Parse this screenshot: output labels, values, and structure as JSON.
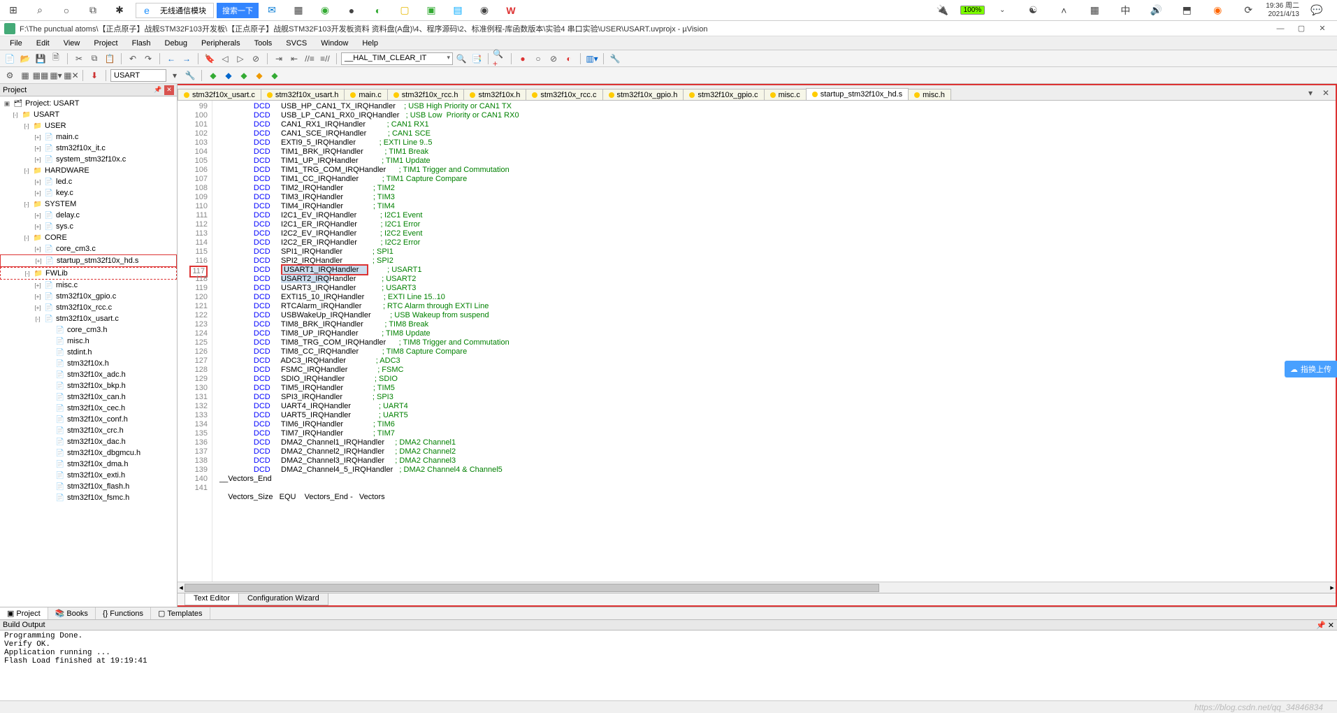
{
  "taskbar": {
    "search_placeholder": "无线通信模块",
    "search_btn": "搜索一下",
    "battery": "100%",
    "clock_time": "19:36 周二",
    "clock_date": "2021/4/13"
  },
  "titlebar": {
    "path": "F:\\The punctual atoms\\【正点原子】战舰STM32F103开发板\\【正点原子】战舰STM32F103开发板资料 资料盘(A盘)\\4、程序源码\\2、标准例程-库函数版本\\实验4 串口实验\\USER\\USART.uvprojx - µVision"
  },
  "menubar": {
    "items": [
      "File",
      "Edit",
      "View",
      "Project",
      "Flash",
      "Debug",
      "Peripherals",
      "Tools",
      "SVCS",
      "Window",
      "Help"
    ]
  },
  "toolbar1": {
    "define": "__HAL_TIM_CLEAR_IT"
  },
  "toolbar2": {
    "target": "USART"
  },
  "project": {
    "header": "Project",
    "root": "Project: USART",
    "tree": [
      {
        "d": 1,
        "t": "folder",
        "exp": "-",
        "label": "USART"
      },
      {
        "d": 2,
        "t": "folder",
        "exp": "-",
        "label": "USER"
      },
      {
        "d": 3,
        "t": "file",
        "exp": "+",
        "label": "main.c"
      },
      {
        "d": 3,
        "t": "file",
        "exp": "+",
        "label": "stm32f10x_it.c"
      },
      {
        "d": 3,
        "t": "file",
        "exp": "+",
        "label": "system_stm32f10x.c"
      },
      {
        "d": 2,
        "t": "folder",
        "exp": "-",
        "label": "HARDWARE"
      },
      {
        "d": 3,
        "t": "file",
        "exp": "+",
        "label": "led.c"
      },
      {
        "d": 3,
        "t": "file",
        "exp": "+",
        "label": "key.c"
      },
      {
        "d": 2,
        "t": "folder",
        "exp": "-",
        "label": "SYSTEM"
      },
      {
        "d": 3,
        "t": "file",
        "exp": "+",
        "label": "delay.c"
      },
      {
        "d": 3,
        "t": "file",
        "exp": "+",
        "label": "sys.c"
      },
      {
        "d": 2,
        "t": "folder",
        "exp": "-",
        "label": "CORE"
      },
      {
        "d": 3,
        "t": "file",
        "exp": "+",
        "label": "core_cm3.c"
      },
      {
        "d": 3,
        "t": "file",
        "exp": "+",
        "label": "startup_stm32f10x_hd.s",
        "sel": "red"
      },
      {
        "d": 2,
        "t": "folder",
        "exp": "-",
        "label": "FWLib",
        "sel": "dash"
      },
      {
        "d": 3,
        "t": "file",
        "exp": "+",
        "label": "misc.c"
      },
      {
        "d": 3,
        "t": "file",
        "exp": "+",
        "label": "stm32f10x_gpio.c"
      },
      {
        "d": 3,
        "t": "file",
        "exp": "+",
        "label": "stm32f10x_rcc.c"
      },
      {
        "d": 3,
        "t": "file",
        "exp": "-",
        "label": "stm32f10x_usart.c"
      },
      {
        "d": 4,
        "t": "h",
        "label": "core_cm3.h"
      },
      {
        "d": 4,
        "t": "h",
        "label": "misc.h"
      },
      {
        "d": 4,
        "t": "h",
        "label": "stdint.h"
      },
      {
        "d": 4,
        "t": "h",
        "label": "stm32f10x.h"
      },
      {
        "d": 4,
        "t": "h",
        "label": "stm32f10x_adc.h"
      },
      {
        "d": 4,
        "t": "h",
        "label": "stm32f10x_bkp.h"
      },
      {
        "d": 4,
        "t": "h",
        "label": "stm32f10x_can.h"
      },
      {
        "d": 4,
        "t": "h",
        "label": "stm32f10x_cec.h"
      },
      {
        "d": 4,
        "t": "h",
        "label": "stm32f10x_conf.h"
      },
      {
        "d": 4,
        "t": "h",
        "label": "stm32f10x_crc.h"
      },
      {
        "d": 4,
        "t": "h",
        "label": "stm32f10x_dac.h"
      },
      {
        "d": 4,
        "t": "h",
        "label": "stm32f10x_dbgmcu.h"
      },
      {
        "d": 4,
        "t": "h",
        "label": "stm32f10x_dma.h"
      },
      {
        "d": 4,
        "t": "h",
        "label": "stm32f10x_exti.h"
      },
      {
        "d": 4,
        "t": "h",
        "label": "stm32f10x_flash.h"
      },
      {
        "d": 4,
        "t": "h",
        "label": "stm32f10x_fsmc.h"
      }
    ]
  },
  "bottom_tabs": [
    "Project",
    "Books",
    "Functions",
    "Templates"
  ],
  "file_tabs": [
    {
      "label": "stm32f10x_usart.c"
    },
    {
      "label": "stm32f10x_usart.h"
    },
    {
      "label": "main.c"
    },
    {
      "label": "stm32f10x_rcc.h"
    },
    {
      "label": "stm32f10x.h"
    },
    {
      "label": "stm32f10x_rcc.c"
    },
    {
      "label": "stm32f10x_gpio.h"
    },
    {
      "label": "stm32f10x_gpio.c"
    },
    {
      "label": "misc.c"
    },
    {
      "label": "startup_stm32f10x_hd.s",
      "active": true
    },
    {
      "label": "misc.h"
    }
  ],
  "code": {
    "lines": [
      {
        "n": 99,
        "ident": "USB_HP_CAN1_TX_IRQHandler",
        "cmt": "; USB High Priority or CAN1 TX"
      },
      {
        "n": 100,
        "ident": "USB_LP_CAN1_RX0_IRQHandler",
        "cmt": "; USB Low  Priority or CAN1 RX0"
      },
      {
        "n": 101,
        "ident": "CAN1_RX1_IRQHandler",
        "cmt": "; CAN1 RX1"
      },
      {
        "n": 102,
        "ident": "CAN1_SCE_IRQHandler",
        "cmt": "; CAN1 SCE"
      },
      {
        "n": 103,
        "ident": "EXTI9_5_IRQHandler",
        "cmt": "; EXTI Line 9..5"
      },
      {
        "n": 104,
        "ident": "TIM1_BRK_IRQHandler",
        "cmt": "; TIM1 Break"
      },
      {
        "n": 105,
        "ident": "TIM1_UP_IRQHandler",
        "cmt": "; TIM1 Update"
      },
      {
        "n": 106,
        "ident": "TIM1_TRG_COM_IRQHandler",
        "cmt": "; TIM1 Trigger and Commutation"
      },
      {
        "n": 107,
        "ident": "TIM1_CC_IRQHandler",
        "cmt": "; TIM1 Capture Compare"
      },
      {
        "n": 108,
        "ident": "TIM2_IRQHandler",
        "cmt": "; TIM2"
      },
      {
        "n": 109,
        "ident": "TIM3_IRQHandler",
        "cmt": "; TIM3"
      },
      {
        "n": 110,
        "ident": "TIM4_IRQHandler",
        "cmt": "; TIM4"
      },
      {
        "n": 111,
        "ident": "I2C1_EV_IRQHandler",
        "cmt": "; I2C1 Event"
      },
      {
        "n": 112,
        "ident": "I2C1_ER_IRQHandler",
        "cmt": "; I2C1 Error"
      },
      {
        "n": 113,
        "ident": "I2C2_EV_IRQHandler",
        "cmt": "; I2C2 Event"
      },
      {
        "n": 114,
        "ident": "I2C2_ER_IRQHandler",
        "cmt": "; I2C2 Error"
      },
      {
        "n": 115,
        "ident": "SPI1_IRQHandler",
        "cmt": "; SPI1"
      },
      {
        "n": 116,
        "ident": "SPI2_IRQHandler",
        "cmt": "; SPI2"
      },
      {
        "n": 117,
        "ident": "USART1_IRQHandler",
        "cmt": "; USART1",
        "hl": "usart1"
      },
      {
        "n": 118,
        "ident": "USART2_IRQHandler",
        "cmt": "; USART2",
        "hl": "usart2"
      },
      {
        "n": 119,
        "ident": "USART3_IRQHandler",
        "cmt": "; USART3"
      },
      {
        "n": 120,
        "ident": "EXTI15_10_IRQHandler",
        "cmt": "; EXTI Line 15..10"
      },
      {
        "n": 121,
        "ident": "RTCAlarm_IRQHandler",
        "cmt": "; RTC Alarm through EXTI Line"
      },
      {
        "n": 122,
        "ident": "USBWakeUp_IRQHandler",
        "cmt": "; USB Wakeup from suspend"
      },
      {
        "n": 123,
        "ident": "TIM8_BRK_IRQHandler",
        "cmt": "; TIM8 Break"
      },
      {
        "n": 124,
        "ident": "TIM8_UP_IRQHandler",
        "cmt": "; TIM8 Update"
      },
      {
        "n": 125,
        "ident": "TIM8_TRG_COM_IRQHandler",
        "cmt": "; TIM8 Trigger and Commutation"
      },
      {
        "n": 126,
        "ident": "TIM8_CC_IRQHandler",
        "cmt": "; TIM8 Capture Compare"
      },
      {
        "n": 127,
        "ident": "ADC3_IRQHandler",
        "cmt": "; ADC3"
      },
      {
        "n": 128,
        "ident": "FSMC_IRQHandler",
        "cmt": "; FSMC"
      },
      {
        "n": 129,
        "ident": "SDIO_IRQHandler",
        "cmt": "; SDIO"
      },
      {
        "n": 130,
        "ident": "TIM5_IRQHandler",
        "cmt": "; TIM5"
      },
      {
        "n": 131,
        "ident": "SPI3_IRQHandler",
        "cmt": "; SPI3"
      },
      {
        "n": 132,
        "ident": "UART4_IRQHandler",
        "cmt": "; UART4"
      },
      {
        "n": 133,
        "ident": "UART5_IRQHandler",
        "cmt": "; UART5"
      },
      {
        "n": 134,
        "ident": "TIM6_IRQHandler",
        "cmt": "; TIM6"
      },
      {
        "n": 135,
        "ident": "TIM7_IRQHandler",
        "cmt": "; TIM7"
      },
      {
        "n": 136,
        "ident": "DMA2_Channel1_IRQHandler",
        "cmt": "; DMA2 Channel1"
      },
      {
        "n": 137,
        "ident": "DMA2_Channel2_IRQHandler",
        "cmt": "; DMA2 Channel2"
      },
      {
        "n": 138,
        "ident": "DMA2_Channel3_IRQHandler",
        "cmt": "; DMA2 Channel3"
      },
      {
        "n": 139,
        "ident": "DMA2_Channel4_5_IRQHandler",
        "cmt": "; DMA2 Channel4 & Channel5"
      }
    ],
    "line140_label": "__Vectors_End",
    "line140_num": "140",
    "line141_num": "141",
    "line143_raw": "Vectors_Size   EQU    Vectors_End -   Vectors"
  },
  "editor_bottom_tabs": [
    "Text Editor",
    "Configuration Wizard"
  ],
  "build": {
    "header": "Build Output",
    "lines": [
      "Programming Done.",
      "Verify OK.",
      "Application running ...",
      "Flash Load finished at 19:19:41"
    ]
  },
  "statusbar": {
    "watermark": "https://blog.csdn.net/qq_34846834"
  },
  "float_badge": "指换上传"
}
